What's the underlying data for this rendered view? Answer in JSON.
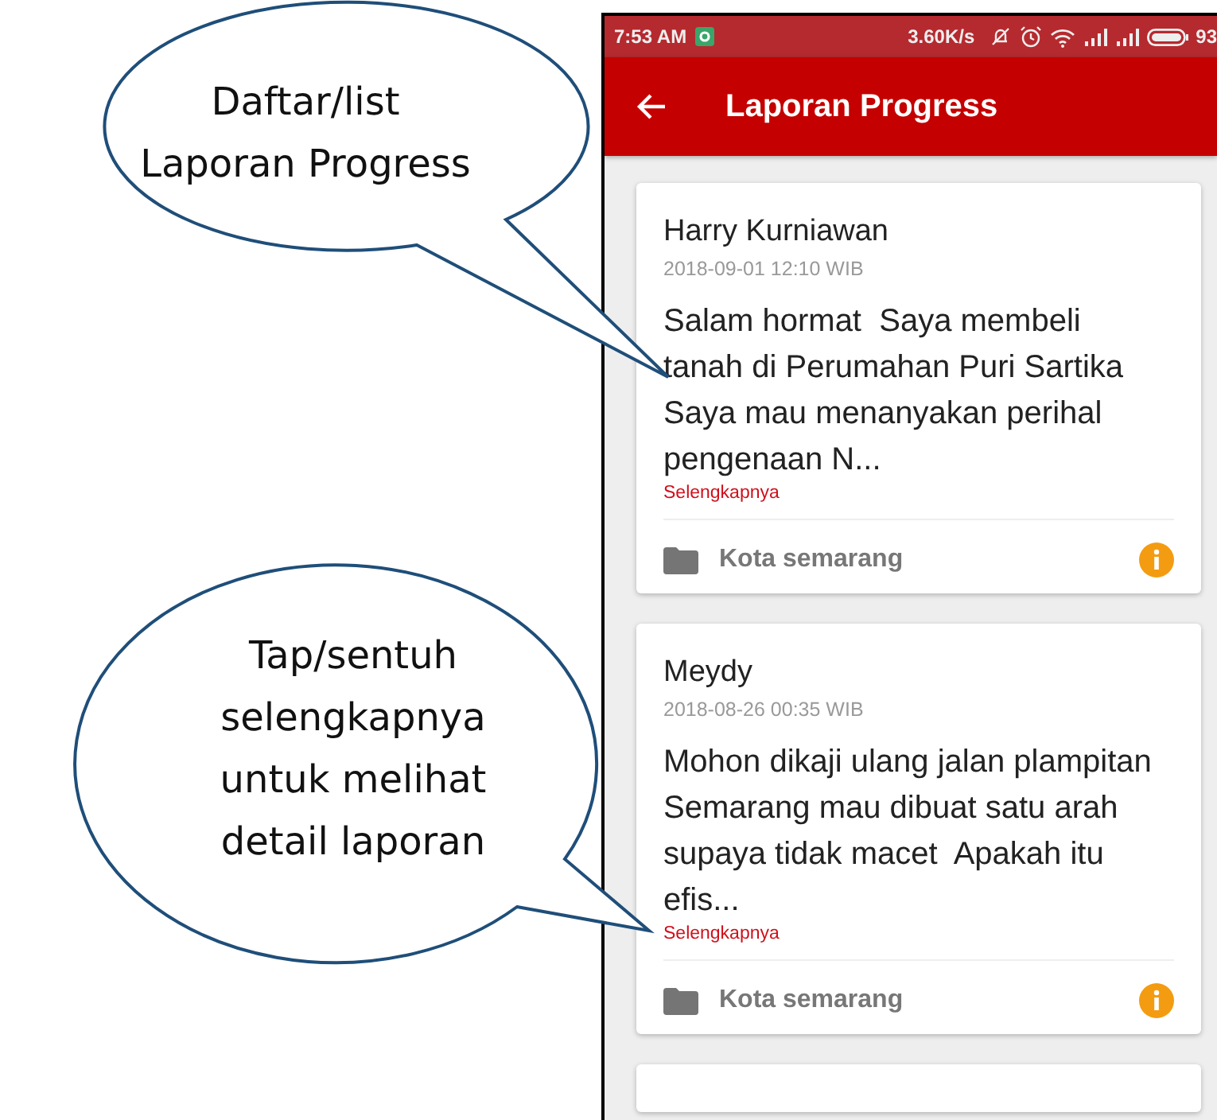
{
  "status_bar": {
    "time": "7:53 AM",
    "speed": "3.60K/s",
    "battery": "93"
  },
  "app_bar": {
    "title": "Laporan Progress"
  },
  "reports": [
    {
      "name": "Harry Kurniawan",
      "date": "2018-09-01 12:10 WIB",
      "body": "Salam hormat  Saya membeli tanah di Perumahan Puri Sartika Saya mau menanyakan perihal pengenaan N...",
      "more": "Selengkapnya",
      "category": "Kota semarang"
    },
    {
      "name": "Meydy",
      "date": "2018-08-26 00:35 WIB",
      "body": "Mohon dikaji ulang jalan plampitan Semarang mau dibuat satu arah supaya tidak macet  Apakah itu efis...",
      "more": "Selengkapnya",
      "category": "Kota semarang"
    }
  ],
  "callouts": [
    {
      "text": "Daftar/list\nLaporan Progress"
    },
    {
      "text": "Tap/sentuh\nselengkapnya\nuntuk melihat\ndetail laporan"
    }
  ]
}
